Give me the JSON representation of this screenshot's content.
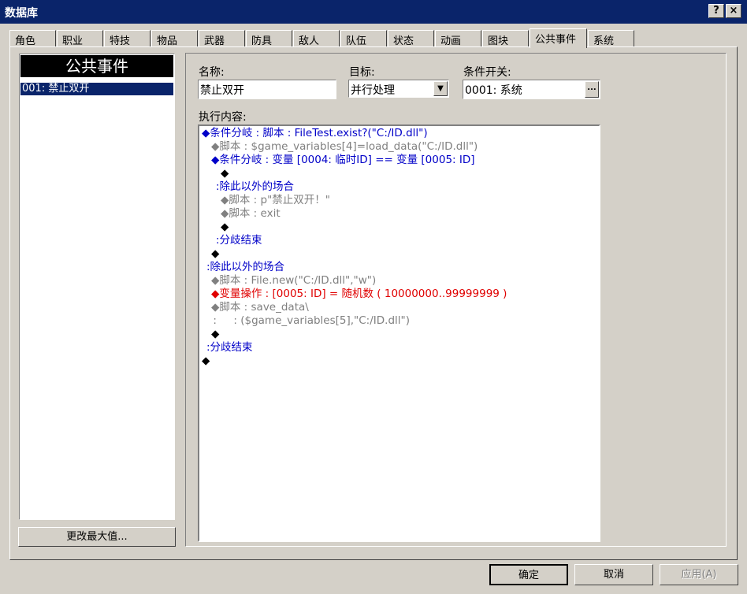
{
  "window": {
    "title": "数据库",
    "help_label": "?",
    "close_label": "×"
  },
  "tabs": [
    {
      "label": "角色"
    },
    {
      "label": "职业"
    },
    {
      "label": "特技"
    },
    {
      "label": "物品"
    },
    {
      "label": "武器"
    },
    {
      "label": "防具"
    },
    {
      "label": "敌人"
    },
    {
      "label": "队伍"
    },
    {
      "label": "状态"
    },
    {
      "label": "动画"
    },
    {
      "label": "图块"
    },
    {
      "label": "公共事件"
    },
    {
      "label": "系统"
    }
  ],
  "active_tab": "公共事件",
  "list": {
    "header": "公共事件",
    "items": [
      {
        "label": "001: 禁止双开"
      }
    ],
    "change_max_label": "更改最大值..."
  },
  "form": {
    "name_label": "名称:",
    "name_value": "禁止双开",
    "target_label": "目标:",
    "target_value": "并行处理",
    "switch_label": "条件开关:",
    "switch_value": "0001: 系统",
    "switch_button": "...",
    "content_label": "执行内容:"
  },
  "code_lines": [
    {
      "text": "◆条件分岐 : 脚本 : FileTest.exist?(\"C:/ID.dll\")",
      "color": "blue",
      "indent": 0
    },
    {
      "text": "◆脚本 : $game_variables[4]=load_data(\"C:/ID.dll\")",
      "color": "gray",
      "indent": 1
    },
    {
      "text": "◆条件分岐 : 变量 [0004: 临时ID] == 变量 [0005: ID]",
      "color": "blue",
      "indent": 1
    },
    {
      "text": "◆",
      "color": "black",
      "indent": 2
    },
    {
      "text": ":除此以外的场合",
      "color": "blue",
      "indent": 1.5
    },
    {
      "text": "◆脚本 : p\"禁止双开！\"",
      "color": "gray",
      "indent": 2
    },
    {
      "text": "◆脚本 : exit",
      "color": "gray",
      "indent": 2
    },
    {
      "text": "◆",
      "color": "black",
      "indent": 2
    },
    {
      "text": ":分歧结束",
      "color": "blue",
      "indent": 1.5
    },
    {
      "text": "◆",
      "color": "black",
      "indent": 1
    },
    {
      "text": ":除此以外的场合",
      "color": "blue",
      "indent": 0.5
    },
    {
      "text": "◆脚本 : File.new(\"C:/ID.dll\",\"w\")",
      "color": "gray",
      "indent": 1
    },
    {
      "text": "◆变量操作 : [0005: ID] = 随机数 ( 10000000..99999999 )",
      "color": "red",
      "indent": 1
    },
    {
      "text": "◆脚本 : save_data\\",
      "color": "gray",
      "indent": 1
    },
    {
      "text": ":     : ($game_variables[5],\"C:/ID.dll\")",
      "color": "gray",
      "indent": 1.2
    },
    {
      "text": "◆",
      "color": "black",
      "indent": 1
    },
    {
      "text": ":分歧结束",
      "color": "blue",
      "indent": 0.5
    },
    {
      "text": "◆",
      "color": "black",
      "indent": 0
    }
  ],
  "footer": {
    "ok_label": "确定",
    "cancel_label": "取消",
    "apply_label": "应用(A)"
  }
}
